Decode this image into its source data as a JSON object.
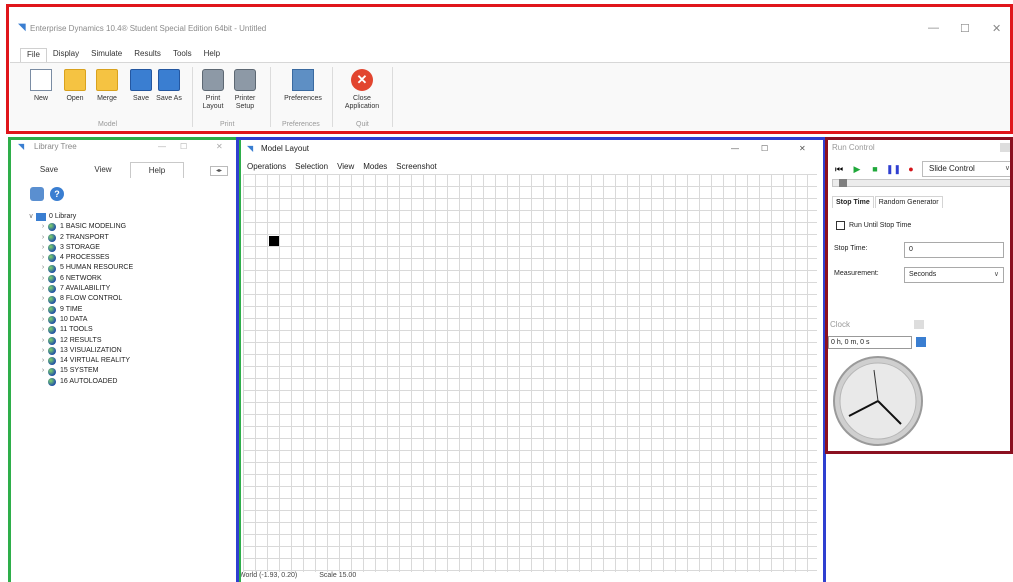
{
  "app": {
    "title": "Enterprise Dynamics 10.4® Student Special Edition 64bit - Untitled",
    "menu": [
      "File",
      "Display",
      "Simulate",
      "Results",
      "Tools",
      "Help"
    ],
    "ribbon_buttons": [
      {
        "label": "New",
        "icon": "new-document-icon"
      },
      {
        "label": "Open",
        "icon": "open-folder-icon"
      },
      {
        "label": "Merge",
        "icon": "merge-folder-icon"
      },
      {
        "label": "Save",
        "icon": "save-disk-icon"
      },
      {
        "label": "Save As",
        "icon": "save-as-disk-icon"
      },
      {
        "label": "Print Layout",
        "icon": "printer-icon"
      },
      {
        "label": "Printer Setup",
        "icon": "printer-setup-icon"
      },
      {
        "label": "Preferences",
        "icon": "preferences-icon"
      },
      {
        "label": "Close Application",
        "icon": "close-application-icon"
      }
    ],
    "groups": [
      "Model",
      "Print",
      "Preferences",
      "Quit"
    ],
    "window_controls": [
      "—",
      "☐",
      "✕"
    ]
  },
  "library": {
    "title": "Library Tree",
    "tabs": [
      "Save",
      "View",
      "Help"
    ],
    "root": "0 Library",
    "items": [
      "1 BASIC MODELING",
      "2 TRANSPORT",
      "3 STORAGE",
      "4 PROCESSES",
      "5 HUMAN RESOURCE",
      "6 NETWORK",
      "7 AVAILABILITY",
      "8 FLOW CONTROL",
      "9 TIME",
      "10 DATA",
      "11 TOOLS",
      "12 RESULTS",
      "13 VISUALIZATION",
      "14 VIRTUAL REALITY",
      "15 SYSTEM",
      "16 AUTOLOADED"
    ]
  },
  "model": {
    "title": "Model Layout",
    "menu": [
      "Operations",
      "Selection",
      "View",
      "Modes",
      "Screenshot"
    ],
    "status_world": "World (-1.93, 0.20)",
    "status_scale": "Scale 15.00"
  },
  "run": {
    "title": "Run Control",
    "speed_mode": "Slide Control",
    "tabs": [
      "Stop Time",
      "Random Generator"
    ],
    "run_until_label": "Run Until Stop Time",
    "run_until_checked": false,
    "stop_time_label": "Stop Time:",
    "stop_time_value": "0",
    "measurement_label": "Measurement:",
    "measurement_value": "Seconds"
  },
  "clock": {
    "title": "Clock",
    "time": "0 h, 0 m, 0 s"
  },
  "colors": {
    "frame_app": "#e0161b",
    "frame_library": "#2eae4a",
    "frame_model": "#2f3fd0",
    "frame_run": "#8b1020"
  }
}
